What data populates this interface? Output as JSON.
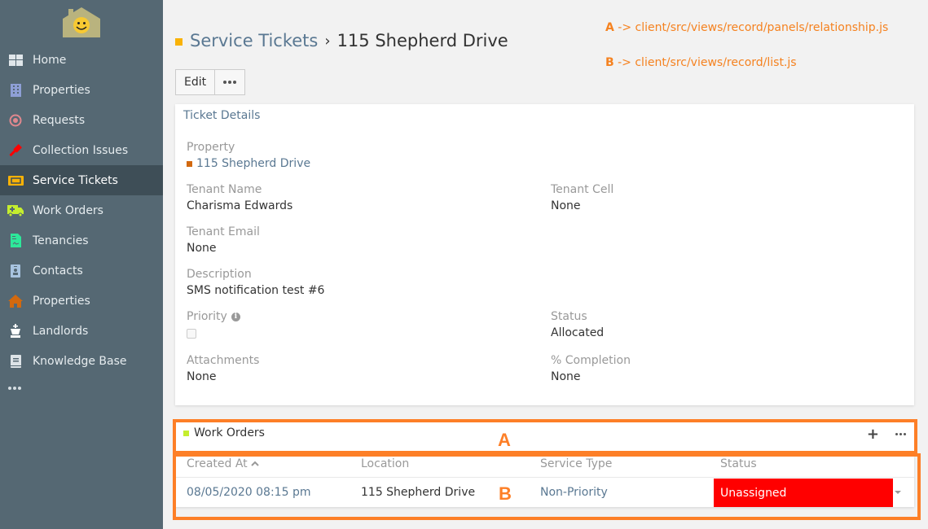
{
  "sidebar": {
    "logo": "smiley-house-logo",
    "items": [
      {
        "label": "Home",
        "icon": "dashboard-grid-icon",
        "color": "#e0e6ea",
        "active": false
      },
      {
        "label": "Properties",
        "icon": "building-icon",
        "color": "#8e9fd6",
        "active": false
      },
      {
        "label": "Requests",
        "icon": "target-icon",
        "color": "#e0888e",
        "active": false
      },
      {
        "label": "Collection Issues",
        "icon": "gavel-icon",
        "color": "#ff0000",
        "active": false
      },
      {
        "label": "Service Tickets",
        "icon": "ticket-icon",
        "color": "#f9b207",
        "active": true
      },
      {
        "label": "Work Orders",
        "icon": "ambulance-icon",
        "color": "#c5ee2e",
        "active": false
      },
      {
        "label": "Tenancies",
        "icon": "contract-icon",
        "color": "#2de89a",
        "active": false
      },
      {
        "label": "Contacts",
        "icon": "id-badge-icon",
        "color": "#a8c4e0",
        "active": false
      },
      {
        "label": "Properties",
        "icon": "home-icon",
        "color": "#d2690f",
        "active": false
      },
      {
        "label": "Landlords",
        "icon": "chess-king-icon",
        "color": "#ffffff",
        "active": false
      },
      {
        "label": "Knowledge Base",
        "icon": "book-icon",
        "color": "#dde3e7",
        "active": false
      }
    ],
    "more": "•••"
  },
  "header": {
    "scope_color": "#f9b207",
    "breadcrumb_link": "Service Tickets",
    "separator": "›",
    "current": "115 Shepherd Drive"
  },
  "annotations": {
    "a_key": "A",
    "a_text": " -> client/src/views/record/panels/relationship.js",
    "b_key": "B",
    "b_text": " -> client/src/views/record/list.js",
    "box_a_label": "A",
    "box_b_label": "B",
    "color": "#fd7f27"
  },
  "toolbar": {
    "edit_label": "Edit"
  },
  "details": {
    "title": "Ticket Details",
    "property_label": "Property",
    "property_value": "115 Shepherd Drive",
    "tenant_name_label": "Tenant Name",
    "tenant_name_value": "Charisma Edwards",
    "tenant_cell_label": "Tenant Cell",
    "tenant_cell_value": "None",
    "tenant_email_label": "Tenant Email",
    "tenant_email_value": "None",
    "description_label": "Description",
    "description_value": "SMS notification test #6",
    "priority_label": "Priority",
    "priority_checked": false,
    "status_label": "Status",
    "status_value": "Allocated",
    "attachments_label": "Attachments",
    "attachments_value": "None",
    "completion_label": "% Completion",
    "completion_value": "None"
  },
  "work_orders": {
    "title": "Work Orders",
    "scope_color": "#c5ee2e",
    "add_label": "+",
    "columns": [
      "Created At",
      "Location",
      "Service Type",
      "Status"
    ],
    "sort_column": "Created At",
    "sort_direction": "ascending",
    "rows": [
      {
        "created_at": "08/05/2020 08:15 pm",
        "location": "115 Shepherd Drive",
        "service_type": "Non-Priority",
        "status": "Unassigned",
        "status_color": "#ff0000"
      }
    ]
  }
}
